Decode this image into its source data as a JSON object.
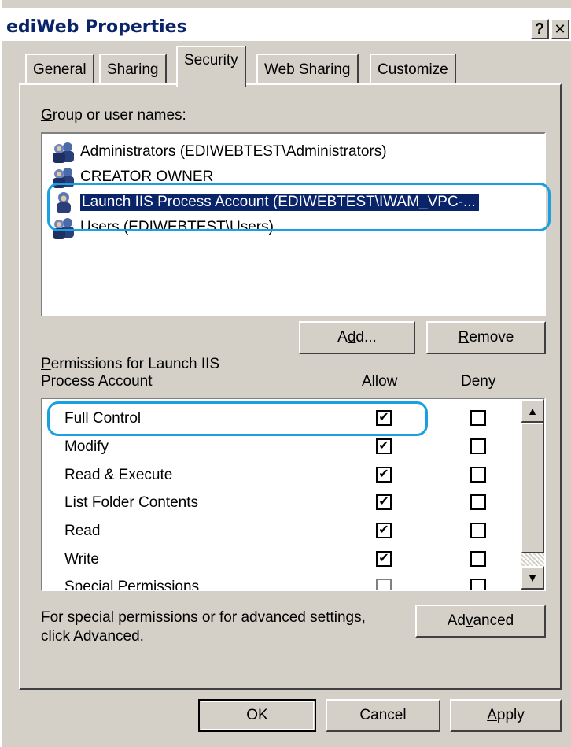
{
  "window": {
    "title": "ediWeb Properties",
    "help_glyph": "?",
    "close_glyph": "✕"
  },
  "tabs": [
    {
      "label": "General",
      "active": false
    },
    {
      "label": "Sharing",
      "active": false
    },
    {
      "label": "Security",
      "active": true
    },
    {
      "label": "Web Sharing",
      "active": false
    },
    {
      "label": "Customize",
      "active": false
    }
  ],
  "groups": {
    "heading_mnemonic": "G",
    "heading_rest": "roup or user names:",
    "items": [
      {
        "label": "Administrators (EDIWEBTEST\\Administrators)",
        "icon": "group-users-icon",
        "selected": false
      },
      {
        "label": "CREATOR OWNER",
        "icon": "group-users-icon",
        "selected": false
      },
      {
        "label": "Launch IIS Process Account (EDIWEBTEST\\IWAM_VPC-...",
        "icon": "user-icon",
        "selected": true
      },
      {
        "label": "Users (EDIWEBTEST\\Users)",
        "icon": "group-users-icon",
        "selected": false
      }
    ]
  },
  "buttons": {
    "add_pre": "A",
    "add_mn": "d",
    "add_post": "d...",
    "remove_mn": "R",
    "remove_post": "emove",
    "advanced_pre": "Ad",
    "advanced_mn": "v",
    "advanced_post": "anced",
    "ok": "OK",
    "cancel": "Cancel",
    "apply_mn": "A",
    "apply_post": "pply"
  },
  "permissions": {
    "heading_mn": "P",
    "heading_line1_rest": "ermissions for Launch IIS",
    "heading_line2": "Process Account",
    "allow_header": "Allow",
    "deny_header": "Deny",
    "rows": [
      {
        "label": "Full Control",
        "allow": true,
        "deny": false
      },
      {
        "label": "Modify",
        "allow": true,
        "deny": false
      },
      {
        "label": "Read & Execute",
        "allow": true,
        "deny": false
      },
      {
        "label": "List Folder Contents",
        "allow": true,
        "deny": false
      },
      {
        "label": "Read",
        "allow": true,
        "deny": false
      },
      {
        "label": "Write",
        "allow": true,
        "deny": false
      },
      {
        "label": "Special Permissions",
        "allow": false,
        "deny": false
      }
    ]
  },
  "advanced_note": {
    "line1": "For special permissions or for advanced settings,",
    "line2": "click Advanced."
  },
  "colors": {
    "selection": "#0a246a",
    "callout": "#1aa0e0",
    "face": "#d4d0c8"
  }
}
